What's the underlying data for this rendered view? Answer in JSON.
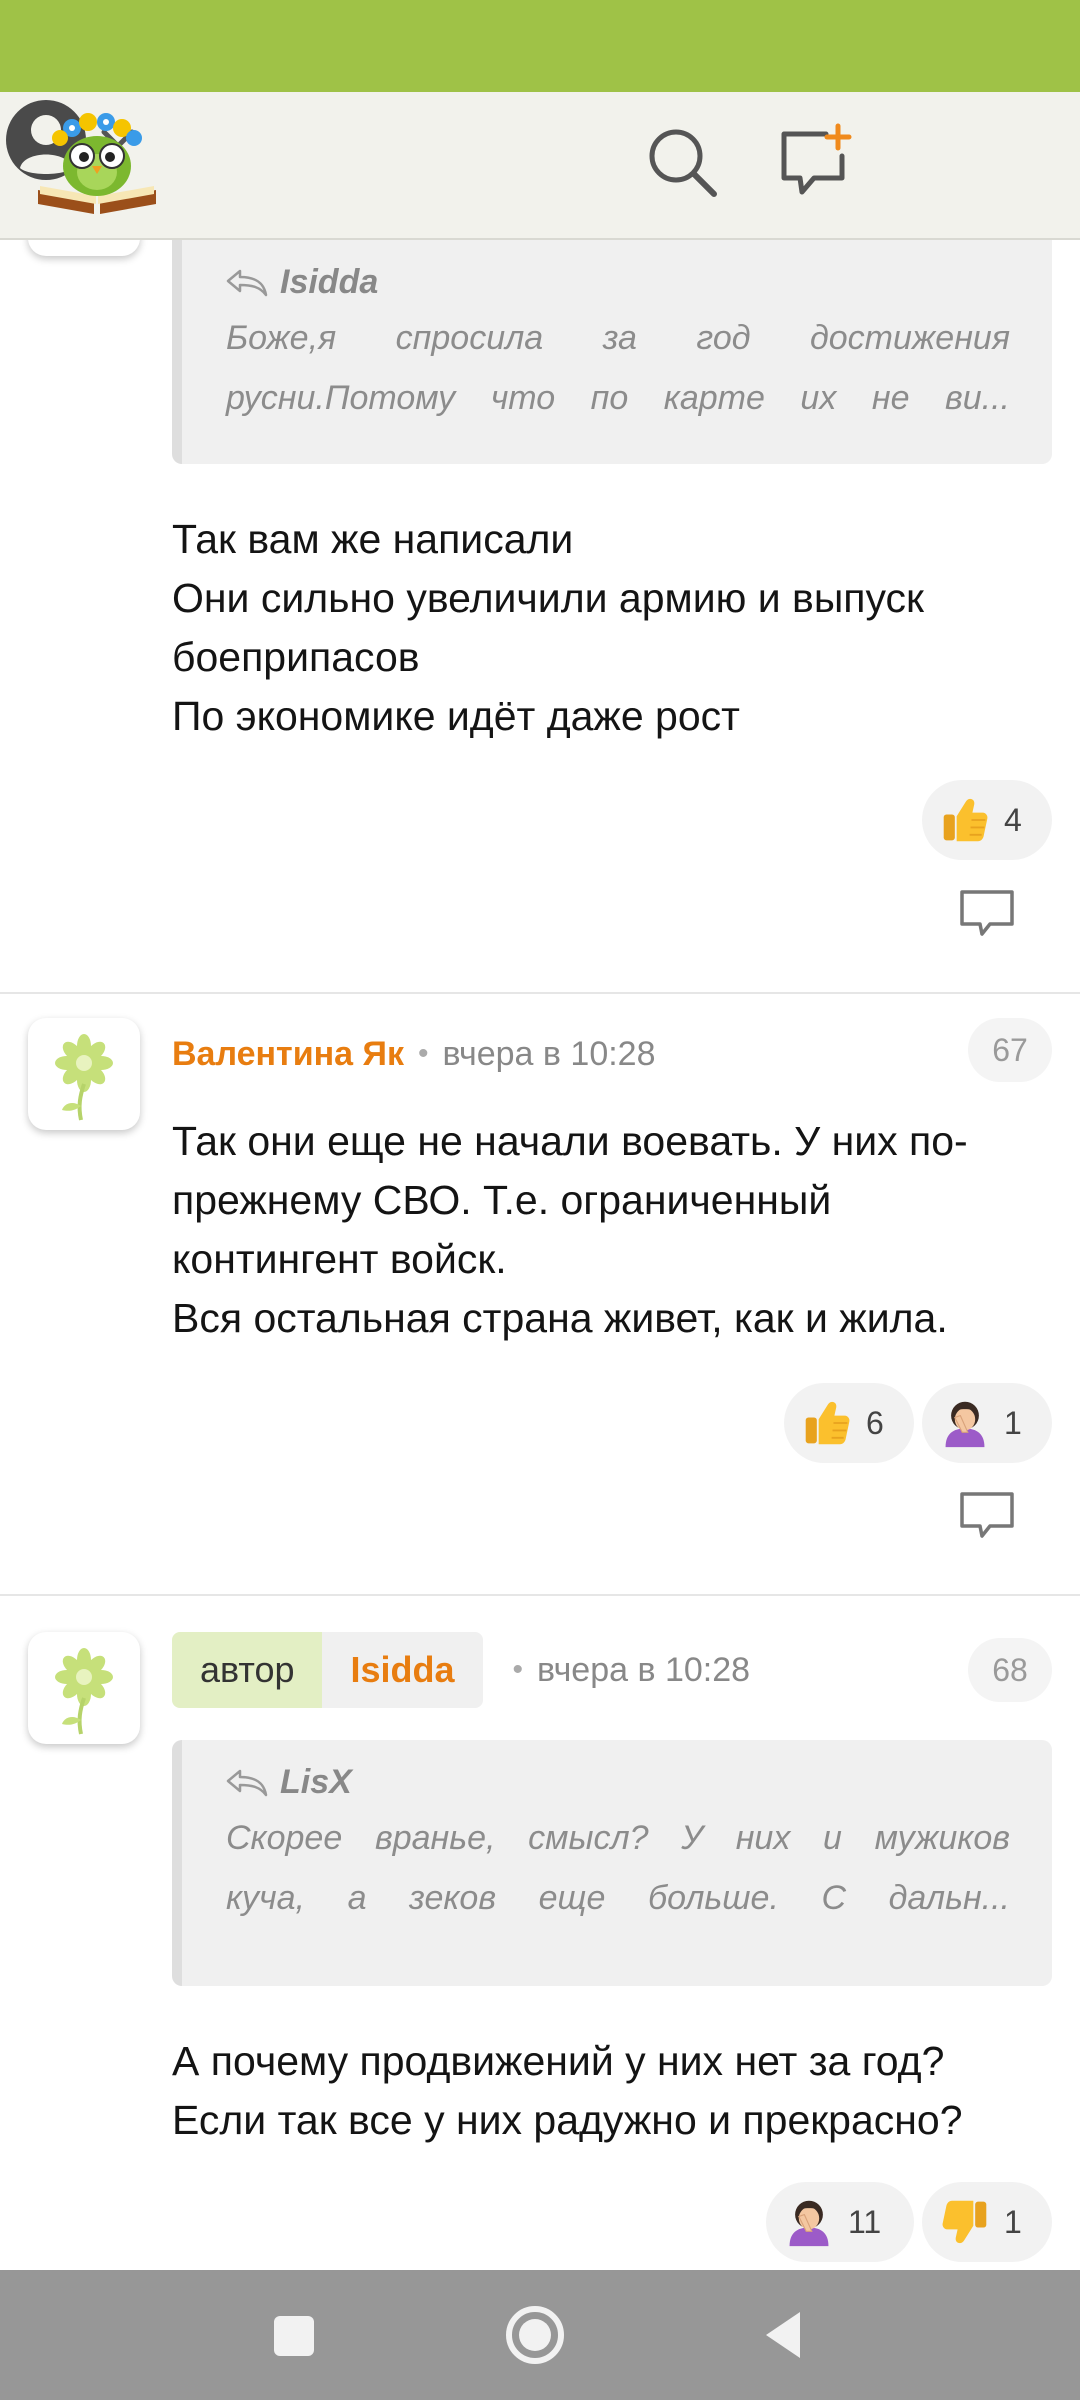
{
  "header": {
    "logo": "logo-owl-on-book",
    "icons": [
      "search-icon",
      "new-post-icon",
      "account-icon",
      "chevron-down-icon"
    ]
  },
  "comments": [
    {
      "quote": {
        "author": "Isidda",
        "lines": [
          "Боже,я спросила за год достижения",
          "русни.Потому что по карте их не ви..."
        ]
      },
      "lines": [
        "Так вам же написали",
        "Они сильно увеличили армию и выпуск",
        "боеприпасов",
        "По экономике идёт даже рост"
      ],
      "reactions": [
        {
          "emoji": "thumbs-up",
          "count": "4"
        }
      ]
    },
    {
      "author": "Валентина Як",
      "time": "вчера в 10:28",
      "number": "67",
      "lines": [
        "Так они еще не начали воевать. У них по-",
        "прежнему СВО. Т.е. ограниченный",
        "контингент войск.",
        "Вся остальная страна живет, как и жила."
      ],
      "reactions": [
        {
          "emoji": "thumbs-up",
          "count": "6"
        },
        {
          "emoji": "facepalm",
          "count": "1"
        }
      ]
    },
    {
      "badge": "автор",
      "author": "Isidda",
      "time": "вчера в 10:28",
      "number": "68",
      "quote": {
        "author": "LisX",
        "lines": [
          "Скорее вранье, смысл? У них и мужиков",
          "куча, а зеков еще больше. С дальн..."
        ]
      },
      "lines": [
        "А почему продвижений у них нет за год?",
        "Если так все у них радужно и прекрасно?"
      ],
      "reactions": [
        {
          "emoji": "facepalm",
          "count": "11"
        },
        {
          "emoji": "thumbs-down",
          "count": "1"
        }
      ]
    }
  ],
  "colors": {
    "status_bar": "#9fc247",
    "header_bg": "#f2f2ec",
    "author_name": "#e87d10",
    "author_badge_bg": "#e3efc4",
    "nav_bar": "#979797"
  }
}
